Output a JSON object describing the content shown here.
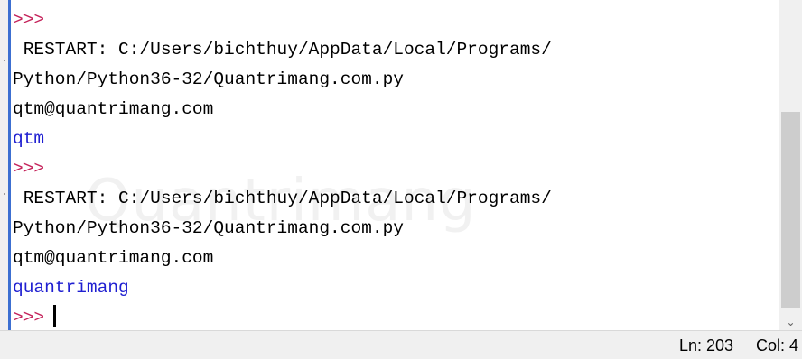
{
  "shell": {
    "lines": [
      {
        "text": ">>>",
        "kind": "prompt"
      },
      {
        "text": " RESTART: C:/Users/bichthuy/AppData/Local/Programs/",
        "kind": "stdout"
      },
      {
        "text": "Python/Python36-32/Quantrimang.com.py",
        "kind": "stdout"
      },
      {
        "text": "qtm@quantrimang.com",
        "kind": "stdout"
      },
      {
        "text": "qtm",
        "kind": "output"
      },
      {
        "text": ">>>",
        "kind": "prompt"
      },
      {
        "text": " RESTART: C:/Users/bichthuy/AppData/Local/Programs/",
        "kind": "stdout"
      },
      {
        "text": "Python/Python36-32/Quantrimang.com.py",
        "kind": "stdout"
      },
      {
        "text": "qtm@quantrimang.com",
        "kind": "stdout"
      },
      {
        "text": "quantrimang",
        "kind": "output"
      },
      {
        "text": ">>>",
        "kind": "prompt"
      }
    ],
    "watermark": "Quantrimang"
  },
  "status": {
    "ln": "Ln: 203",
    "col": "Col: 4"
  },
  "scrollbar": {
    "down_arrow": "⌄"
  },
  "colors": {
    "prompt": "#c4225a",
    "output": "#1f1fd1",
    "stdout": "#000000"
  }
}
